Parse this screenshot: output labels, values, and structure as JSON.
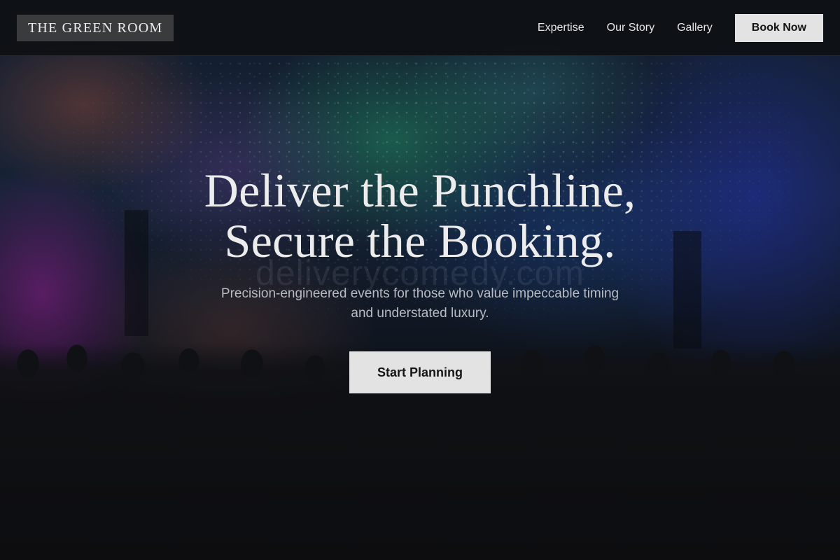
{
  "header": {
    "brand": "THE GREEN ROOM",
    "nav": [
      {
        "label": "Expertise"
      },
      {
        "label": "Our Story"
      },
      {
        "label": "Gallery"
      }
    ],
    "cta_label": "Book Now"
  },
  "hero": {
    "headline_line1": "Deliver the Punchline,",
    "headline_line2": "Secure the Booking.",
    "watermark": "deliverycomedy.com",
    "subhead_line1": "Precision-engineered events for those who value impeccable timing",
    "subhead_line2": "and understated luxury.",
    "cta_label": "Start Planning"
  },
  "colors": {
    "header_bg": "#0e1013",
    "brand_bg": "#3a3b3d",
    "button_bg": "#e3e3e3",
    "text_light": "#ececec"
  },
  "icons": {
    "background": "concert-crowd-stage-lights-image"
  }
}
